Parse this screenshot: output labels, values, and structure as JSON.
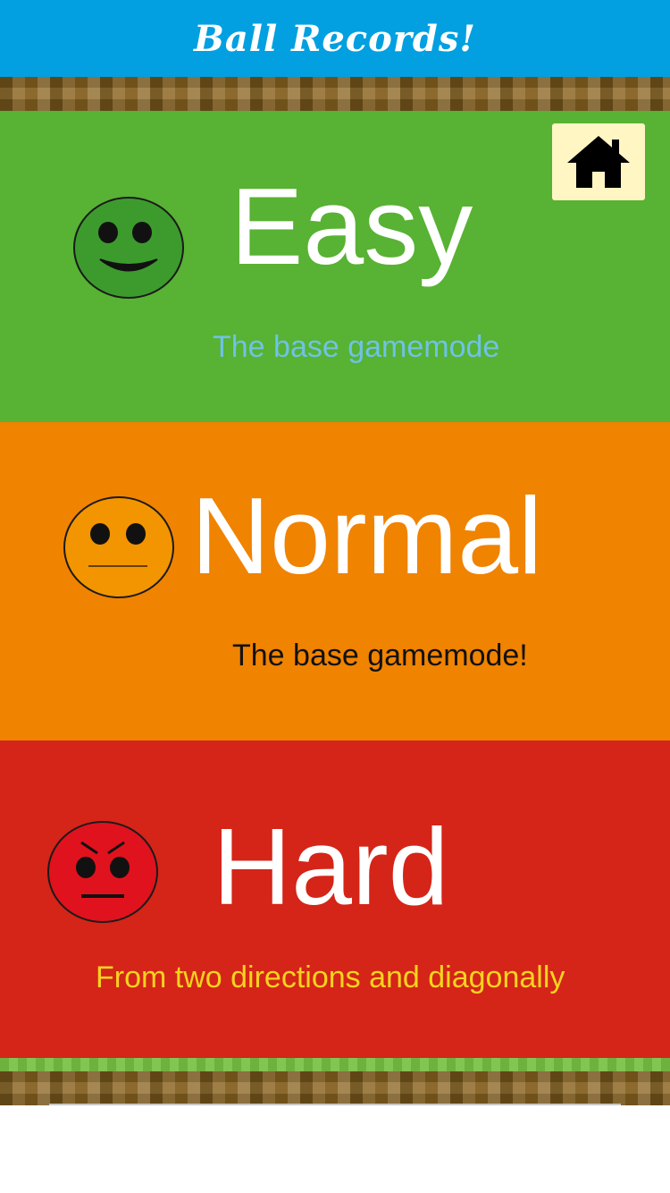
{
  "header": {
    "title": "Ball Records!"
  },
  "home_button": {
    "icon": "home-icon"
  },
  "modes": [
    {
      "id": "easy",
      "title": "Easy",
      "description": "The base gamemode",
      "color": "#58b233",
      "description_color": "#6ec3e6",
      "face": "happy-face-icon",
      "face_color": "#3d9b2e"
    },
    {
      "id": "normal",
      "title": "Normal",
      "description": "The base gamemode!",
      "color": "#f08300",
      "description_color": "#111111",
      "face": "neutral-face-icon",
      "face_color": "#f29500"
    },
    {
      "id": "hard",
      "title": "Hard",
      "description": "From two directions and diagonally",
      "color": "#d42518",
      "description_color": "#f6d31e",
      "face": "angry-face-icon",
      "face_color": "#e0121e"
    }
  ]
}
